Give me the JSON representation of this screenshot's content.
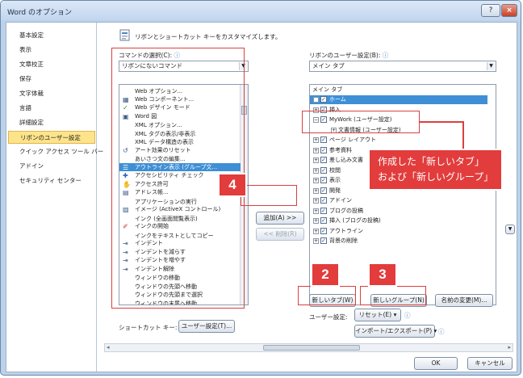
{
  "window": {
    "title": "Word のオプション",
    "help": "?",
    "close": "×"
  },
  "nav": {
    "items": [
      {
        "label": "基本設定"
      },
      {
        "label": "表示"
      },
      {
        "label": "文章校正"
      },
      {
        "label": "保存"
      },
      {
        "label": "文字体裁"
      },
      {
        "label": "言語"
      },
      {
        "label": "詳細設定"
      },
      {
        "label": "リボンのユーザー設定",
        "selected": true
      },
      {
        "label": "クイック アクセス ツール バー"
      },
      {
        "label": "アドイン"
      },
      {
        "label": "セキュリティ センター"
      }
    ]
  },
  "header": {
    "text": "リボンとショートカット キーをカスタマイズします。"
  },
  "commands": {
    "label": "コマンドの選択(C):",
    "info_icon": "ⓘ",
    "selected_option": "リボンにないコマンド",
    "list": [
      {
        "label": "Web オプション...",
        "icon": "none"
      },
      {
        "label": "Web コンポーネント...",
        "icon": "component"
      },
      {
        "label": "Web デザイン モード",
        "icon": "check"
      },
      {
        "label": "Word 図",
        "icon": "picture"
      },
      {
        "label": "XML オプション...",
        "icon": "none"
      },
      {
        "label": "XML タグの表示/非表示",
        "icon": "none"
      },
      {
        "label": "XML データ構造の表示",
        "icon": "none"
      },
      {
        "label": "アート効果のリセット",
        "icon": "reset"
      },
      {
        "label": "あいさつ文の編集...",
        "icon": "none"
      },
      {
        "label": "アウトライン表示 (グループ文...",
        "icon": "outline",
        "selected": true
      },
      {
        "label": "アクセシビリティ チェック",
        "icon": "access"
      },
      {
        "label": "アクセス許可",
        "icon": "perm"
      },
      {
        "label": "アドレス帳...",
        "icon": "addr"
      },
      {
        "label": "アプリケーションの実行",
        "icon": "none"
      },
      {
        "label": "イメージ (ActiveX コントロール)",
        "icon": "image"
      },
      {
        "label": "インク (全画面閲覧表示)",
        "icon": "none"
      },
      {
        "label": "インクの開始",
        "icon": "ink"
      },
      {
        "label": "インクをテキストとしてコピー",
        "icon": "none"
      },
      {
        "label": "インデント",
        "icon": "indent"
      },
      {
        "label": "インデントを減らす",
        "icon": "indent"
      },
      {
        "label": "インデントを増やす",
        "icon": "indent"
      },
      {
        "label": "インデント解除",
        "icon": "indent"
      },
      {
        "label": "ウィンドウの移動",
        "icon": "none"
      },
      {
        "label": "ウィンドウの先頭へ移動",
        "icon": "none"
      },
      {
        "label": "ウィンドウの先頭まで選択",
        "icon": "none"
      },
      {
        "label": "ウィンドウの末尾へ移動",
        "icon": "none"
      }
    ]
  },
  "ribbon": {
    "label": "リボンのユーザー設定(B):",
    "info_icon": "ⓘ",
    "selected_option": "メイン タブ",
    "tree_header": "メイン タブ",
    "tree": [
      {
        "label": "ホーム",
        "sign": "+",
        "checked": true,
        "selected": true,
        "level": 0
      },
      {
        "label": "挿入",
        "sign": "+",
        "checked": true,
        "level": 0
      },
      {
        "label": "MyWork (ユーザー設定)",
        "sign": "−",
        "checked": true,
        "level": 0
      },
      {
        "label": "文書情報 (ユーザー設定)",
        "sign": "+",
        "checked": false,
        "level": 1
      },
      {
        "label": "ページ レイアウト",
        "sign": "+",
        "checked": true,
        "level": 0
      },
      {
        "label": "参考資料",
        "sign": "+",
        "checked": true,
        "level": 0
      },
      {
        "label": "差し込み文書",
        "sign": "+",
        "checked": true,
        "level": 0
      },
      {
        "label": "校閲",
        "sign": "+",
        "checked": true,
        "level": 0
      },
      {
        "label": "表示",
        "sign": "+",
        "checked": true,
        "level": 0
      },
      {
        "label": "開発",
        "sign": "+",
        "checked": true,
        "level": 0
      },
      {
        "label": "アドイン",
        "sign": "+",
        "checked": true,
        "level": 0
      },
      {
        "label": "ブログの投稿",
        "sign": "+",
        "checked": true,
        "level": 0
      },
      {
        "label": "挿入 (ブログの投稿)",
        "sign": "+",
        "checked": true,
        "level": 0
      },
      {
        "label": "アウトライン",
        "sign": "+",
        "checked": true,
        "level": 0
      },
      {
        "label": "背景の削除",
        "sign": "+",
        "checked": true,
        "level": 0
      }
    ],
    "new_tab": "新しいタブ(W)",
    "new_group": "新しいグループ(N)",
    "rename": "名前の変更(M)...",
    "user_setting_label": "ユーザー設定:",
    "reset": "リセット(E) ▾",
    "import_export": "インポート/エクスポート(P) ▾"
  },
  "add_button": "追加(A) >>",
  "remove_button": "<< 削除(R)",
  "shortcut": {
    "label": "ショートカット キー:",
    "button": "ユーザー設定(T)..."
  },
  "footer": {
    "ok": "OK",
    "cancel": "キャンセル"
  },
  "annotations": {
    "badge2": "2",
    "badge3": "3",
    "badge4": "4",
    "callout_line1": "作成した「新しいタブ」",
    "callout_line2": "および「新しいグループ」"
  },
  "colors": {
    "accent": "#3e8fd6",
    "annotation": "#e23c3c",
    "nav_selected": "#fde48b"
  }
}
